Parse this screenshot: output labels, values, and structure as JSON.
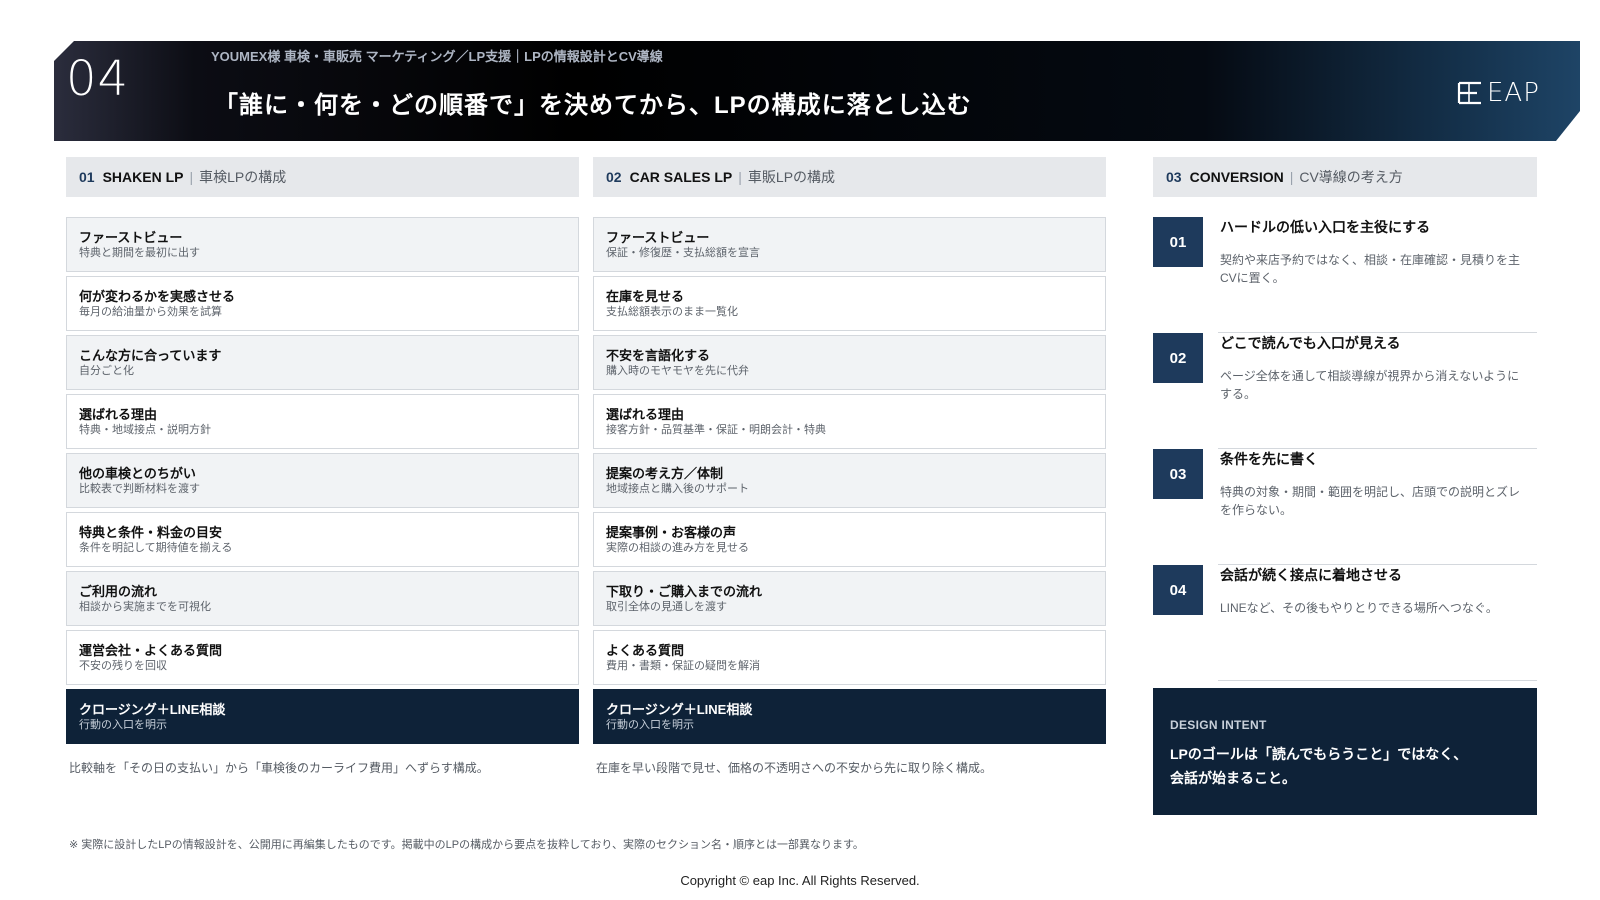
{
  "header": {
    "number": "04",
    "breadcrumb": "YOUMEX様 車検・車販売 マーケティング／LP支援｜LPの情報設計とCV導線",
    "title": "「誰に・何を・どの順番で」を決めてから、LPの構成に落とし込む",
    "logo_text": "EAP"
  },
  "columns": [
    {
      "num": "01",
      "en": "SHAKEN LP",
      "sep": "|",
      "jp": "車検LPの構成",
      "items": [
        {
          "title": "ファーストビュー",
          "sub": "特典と期間を最初に出す"
        },
        {
          "title": "何が変わるかを実感させる",
          "sub": "毎月の給油量から効果を試算"
        },
        {
          "title": "こんな方に合っています",
          "sub": "自分ごと化"
        },
        {
          "title": "選ばれる理由",
          "sub": "特典・地域接点・説明方針"
        },
        {
          "title": "他の車検とのちがい",
          "sub": "比較表で判断材料を渡す"
        },
        {
          "title": "特典と条件・料金の目安",
          "sub": "条件を明記して期待値を揃える"
        },
        {
          "title": "ご利用の流れ",
          "sub": "相談から実施までを可視化"
        },
        {
          "title": "運営会社・よくある質問",
          "sub": "不安の残りを回収"
        },
        {
          "title": "クロージング＋LINE相談",
          "sub": "行動の入口を明示"
        }
      ],
      "note": "比較軸を「その日の支払い」から「車検後のカーライフ費用」へずらす構成。"
    },
    {
      "num": "02",
      "en": "CAR SALES LP",
      "sep": "|",
      "jp": "車販LPの構成",
      "items": [
        {
          "title": "ファーストビュー",
          "sub": "保証・修復歴・支払総額を宣言"
        },
        {
          "title": "在庫を見せる",
          "sub": "支払総額表示のまま一覧化"
        },
        {
          "title": "不安を言語化する",
          "sub": "購入時のモヤモヤを先に代弁"
        },
        {
          "title": "選ばれる理由",
          "sub": "接客方針・品質基準・保証・明朗会計・特典"
        },
        {
          "title": "提案の考え方／体制",
          "sub": "地域接点と購入後のサポート"
        },
        {
          "title": "提案事例・お客様の声",
          "sub": "実際の相談の進み方を見せる"
        },
        {
          "title": "下取り・ご購入までの流れ",
          "sub": "取引全体の見通しを渡す"
        },
        {
          "title": "よくある質問",
          "sub": "費用・書類・保証の疑問を解消"
        },
        {
          "title": "クロージング＋LINE相談",
          "sub": "行動の入口を明示"
        }
      ],
      "note": "在庫を早い段階で見せ、価格の不透明さへの不安から先に取り除く構成。"
    }
  ],
  "conversion": {
    "num": "03",
    "en": "CONVERSION",
    "sep": "|",
    "jp": "CV導線の考え方",
    "points": [
      {
        "num": "01",
        "title": "ハードルの低い入口を主役にする",
        "desc": "契約や来店予約ではなく、相談・在庫確認・見積りを主CVに置く。"
      },
      {
        "num": "02",
        "title": "どこで読んでも入口が見える",
        "desc": "ページ全体を通して相談導線が視界から消えないようにする。"
      },
      {
        "num": "03",
        "title": "条件を先に書く",
        "desc": "特典の対象・期間・範囲を明記し、店頭での説明とズレを作らない。"
      },
      {
        "num": "04",
        "title": "会話が続く接点に着地させる",
        "desc": "LINEなど、その後もやりとりできる場所へつなぐ。"
      }
    ]
  },
  "design_intent": {
    "label": "DESIGN INTENT",
    "line1": "LPのゴールは「読んでもらうこと」ではなく、",
    "line2": "会話が始まること。"
  },
  "footer": {
    "disclaimer": "※ 実際に設計したLPの情報設計を、公開用に再編集したものです。掲載中のLPの構成から要点を抜粋しており、実際のセクション名・順序とは一部異なります。",
    "copyright": "Copyright © eap Inc. All Rights Reserved."
  },
  "colors": {
    "navy": "#0e2238",
    "accent": "#1e3a5c",
    "panel_gray": "#e6e8eb",
    "row_gray": "#f1f3f5"
  }
}
